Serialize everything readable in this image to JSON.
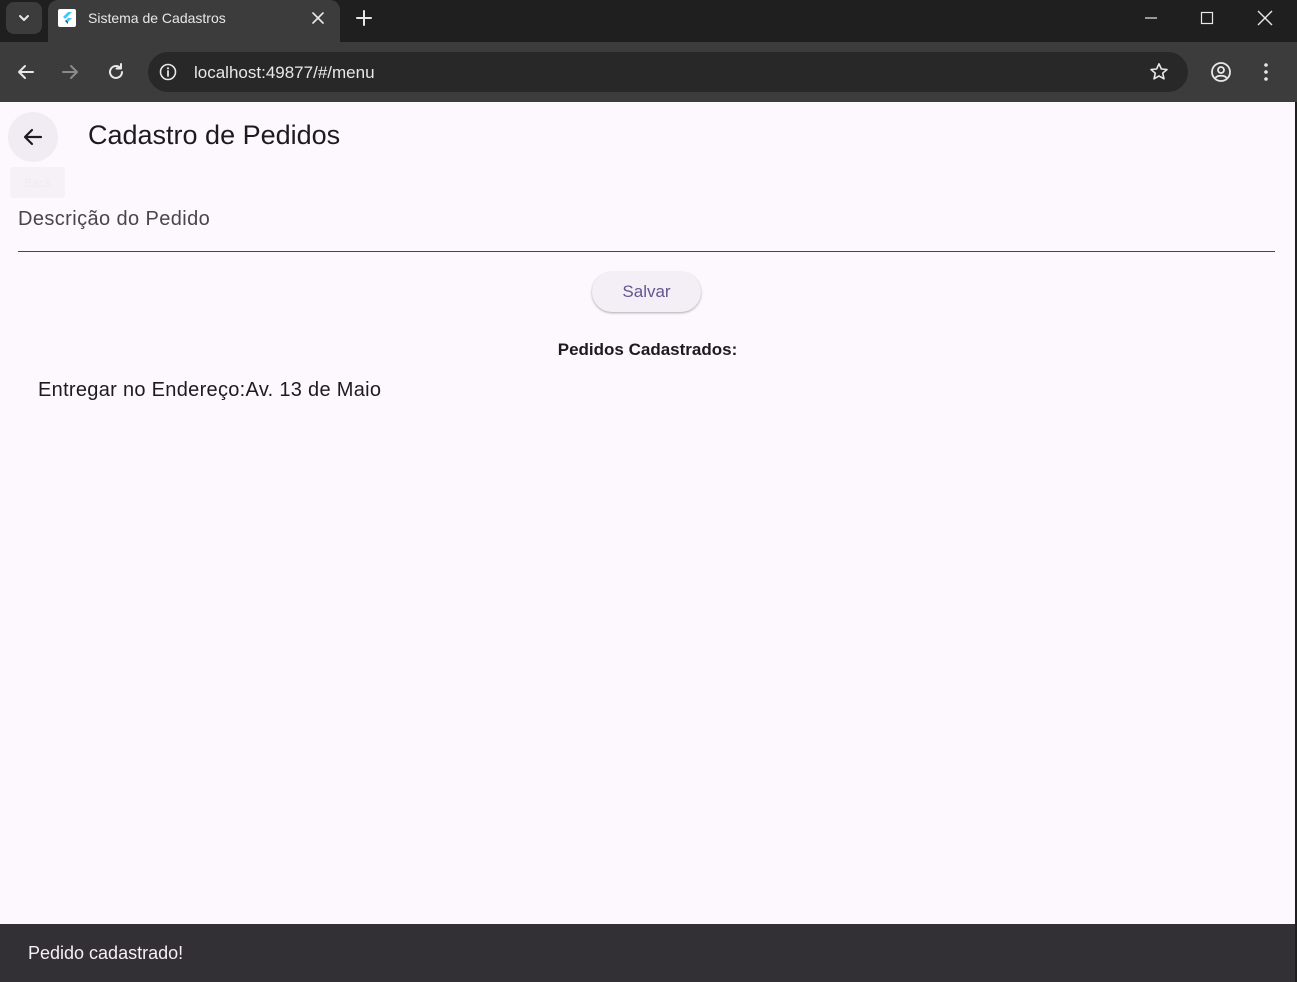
{
  "browser": {
    "tab_title": "Sistema de Cadastros",
    "url": "localhost:49877/#/menu"
  },
  "app": {
    "page_title": "Cadastro de Pedidos",
    "back_tooltip": "Back",
    "field_label": "Descrição do Pedido",
    "save_label": "Salvar",
    "list_header": "Pedidos Cadastrados:",
    "items": [
      "Entregar no Endereço:Av. 13 de Maio"
    ],
    "snackbar_text": "Pedido cadastrado!"
  }
}
